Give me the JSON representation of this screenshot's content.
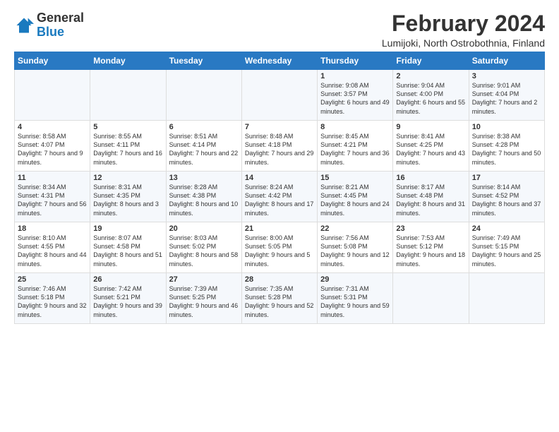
{
  "logo": {
    "general": "General",
    "blue": "Blue"
  },
  "title": "February 2024",
  "subtitle": "Lumijoki, North Ostrobothnia, Finland",
  "days_header": [
    "Sunday",
    "Monday",
    "Tuesday",
    "Wednesday",
    "Thursday",
    "Friday",
    "Saturday"
  ],
  "weeks": [
    [
      {
        "day": "",
        "sunrise": "",
        "sunset": "",
        "daylight": ""
      },
      {
        "day": "",
        "sunrise": "",
        "sunset": "",
        "daylight": ""
      },
      {
        "day": "",
        "sunrise": "",
        "sunset": "",
        "daylight": ""
      },
      {
        "day": "",
        "sunrise": "",
        "sunset": "",
        "daylight": ""
      },
      {
        "day": "1",
        "sunrise": "Sunrise: 9:08 AM",
        "sunset": "Sunset: 3:57 PM",
        "daylight": "Daylight: 6 hours and 49 minutes."
      },
      {
        "day": "2",
        "sunrise": "Sunrise: 9:04 AM",
        "sunset": "Sunset: 4:00 PM",
        "daylight": "Daylight: 6 hours and 55 minutes."
      },
      {
        "day": "3",
        "sunrise": "Sunrise: 9:01 AM",
        "sunset": "Sunset: 4:04 PM",
        "daylight": "Daylight: 7 hours and 2 minutes."
      }
    ],
    [
      {
        "day": "4",
        "sunrise": "Sunrise: 8:58 AM",
        "sunset": "Sunset: 4:07 PM",
        "daylight": "Daylight: 7 hours and 9 minutes."
      },
      {
        "day": "5",
        "sunrise": "Sunrise: 8:55 AM",
        "sunset": "Sunset: 4:11 PM",
        "daylight": "Daylight: 7 hours and 16 minutes."
      },
      {
        "day": "6",
        "sunrise": "Sunrise: 8:51 AM",
        "sunset": "Sunset: 4:14 PM",
        "daylight": "Daylight: 7 hours and 22 minutes."
      },
      {
        "day": "7",
        "sunrise": "Sunrise: 8:48 AM",
        "sunset": "Sunset: 4:18 PM",
        "daylight": "Daylight: 7 hours and 29 minutes."
      },
      {
        "day": "8",
        "sunrise": "Sunrise: 8:45 AM",
        "sunset": "Sunset: 4:21 PM",
        "daylight": "Daylight: 7 hours and 36 minutes."
      },
      {
        "day": "9",
        "sunrise": "Sunrise: 8:41 AM",
        "sunset": "Sunset: 4:25 PM",
        "daylight": "Daylight: 7 hours and 43 minutes."
      },
      {
        "day": "10",
        "sunrise": "Sunrise: 8:38 AM",
        "sunset": "Sunset: 4:28 PM",
        "daylight": "Daylight: 7 hours and 50 minutes."
      }
    ],
    [
      {
        "day": "11",
        "sunrise": "Sunrise: 8:34 AM",
        "sunset": "Sunset: 4:31 PM",
        "daylight": "Daylight: 7 hours and 56 minutes."
      },
      {
        "day": "12",
        "sunrise": "Sunrise: 8:31 AM",
        "sunset": "Sunset: 4:35 PM",
        "daylight": "Daylight: 8 hours and 3 minutes."
      },
      {
        "day": "13",
        "sunrise": "Sunrise: 8:28 AM",
        "sunset": "Sunset: 4:38 PM",
        "daylight": "Daylight: 8 hours and 10 minutes."
      },
      {
        "day": "14",
        "sunrise": "Sunrise: 8:24 AM",
        "sunset": "Sunset: 4:42 PM",
        "daylight": "Daylight: 8 hours and 17 minutes."
      },
      {
        "day": "15",
        "sunrise": "Sunrise: 8:21 AM",
        "sunset": "Sunset: 4:45 PM",
        "daylight": "Daylight: 8 hours and 24 minutes."
      },
      {
        "day": "16",
        "sunrise": "Sunrise: 8:17 AM",
        "sunset": "Sunset: 4:48 PM",
        "daylight": "Daylight: 8 hours and 31 minutes."
      },
      {
        "day": "17",
        "sunrise": "Sunrise: 8:14 AM",
        "sunset": "Sunset: 4:52 PM",
        "daylight": "Daylight: 8 hours and 37 minutes."
      }
    ],
    [
      {
        "day": "18",
        "sunrise": "Sunrise: 8:10 AM",
        "sunset": "Sunset: 4:55 PM",
        "daylight": "Daylight: 8 hours and 44 minutes."
      },
      {
        "day": "19",
        "sunrise": "Sunrise: 8:07 AM",
        "sunset": "Sunset: 4:58 PM",
        "daylight": "Daylight: 8 hours and 51 minutes."
      },
      {
        "day": "20",
        "sunrise": "Sunrise: 8:03 AM",
        "sunset": "Sunset: 5:02 PM",
        "daylight": "Daylight: 8 hours and 58 minutes."
      },
      {
        "day": "21",
        "sunrise": "Sunrise: 8:00 AM",
        "sunset": "Sunset: 5:05 PM",
        "daylight": "Daylight: 9 hours and 5 minutes."
      },
      {
        "day": "22",
        "sunrise": "Sunrise: 7:56 AM",
        "sunset": "Sunset: 5:08 PM",
        "daylight": "Daylight: 9 hours and 12 minutes."
      },
      {
        "day": "23",
        "sunrise": "Sunrise: 7:53 AM",
        "sunset": "Sunset: 5:12 PM",
        "daylight": "Daylight: 9 hours and 18 minutes."
      },
      {
        "day": "24",
        "sunrise": "Sunrise: 7:49 AM",
        "sunset": "Sunset: 5:15 PM",
        "daylight": "Daylight: 9 hours and 25 minutes."
      }
    ],
    [
      {
        "day": "25",
        "sunrise": "Sunrise: 7:46 AM",
        "sunset": "Sunset: 5:18 PM",
        "daylight": "Daylight: 9 hours and 32 minutes."
      },
      {
        "day": "26",
        "sunrise": "Sunrise: 7:42 AM",
        "sunset": "Sunset: 5:21 PM",
        "daylight": "Daylight: 9 hours and 39 minutes."
      },
      {
        "day": "27",
        "sunrise": "Sunrise: 7:39 AM",
        "sunset": "Sunset: 5:25 PM",
        "daylight": "Daylight: 9 hours and 46 minutes."
      },
      {
        "day": "28",
        "sunrise": "Sunrise: 7:35 AM",
        "sunset": "Sunset: 5:28 PM",
        "daylight": "Daylight: 9 hours and 52 minutes."
      },
      {
        "day": "29",
        "sunrise": "Sunrise: 7:31 AM",
        "sunset": "Sunset: 5:31 PM",
        "daylight": "Daylight: 9 hours and 59 minutes."
      },
      {
        "day": "",
        "sunrise": "",
        "sunset": "",
        "daylight": ""
      },
      {
        "day": "",
        "sunrise": "",
        "sunset": "",
        "daylight": ""
      }
    ]
  ]
}
